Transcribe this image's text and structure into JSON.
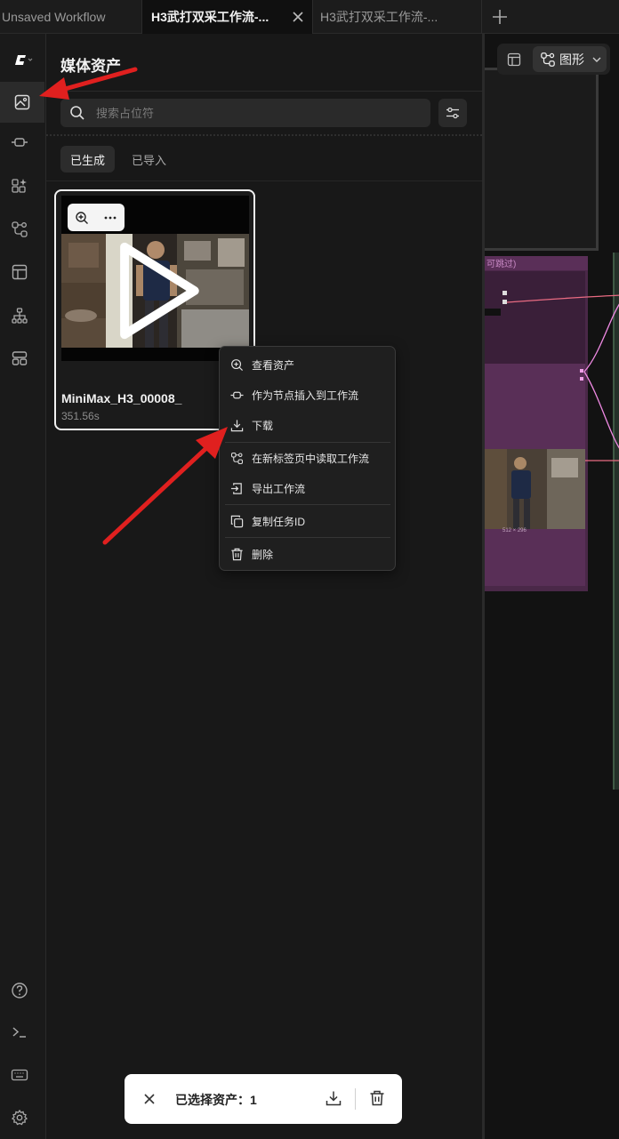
{
  "tabs": [
    {
      "label": "Unsaved Workflow"
    },
    {
      "label": "H3武打双采工作流-..."
    },
    {
      "label": "H3武打双采工作流-..."
    }
  ],
  "panel": {
    "title": "媒体资产",
    "search_placeholder": "搜索占位符",
    "subtabs": [
      "已生成",
      "已导入"
    ]
  },
  "asset": {
    "name": "MiniMax_H3_00008_",
    "duration": "351.56s"
  },
  "context_menu": {
    "items": [
      {
        "label": "查看资产",
        "icon": "zoom-in-icon"
      },
      {
        "label": "作为节点插入到工作流",
        "icon": "node-insert-icon"
      },
      {
        "label": "下载",
        "icon": "download-icon"
      },
      {
        "label": "在新标签页中读取工作流",
        "icon": "workflow-icon"
      },
      {
        "label": "导出工作流",
        "icon": "export-icon"
      },
      {
        "label": "复制任务ID",
        "icon": "copy-icon"
      },
      {
        "label": "删除",
        "icon": "trash-icon"
      }
    ]
  },
  "canvas": {
    "view_mode": "图形",
    "node_header": "可跳过)",
    "thumb_label": "512 × 296"
  },
  "selection_bar": {
    "label": "已选择资产：1"
  },
  "colors": {
    "annotation_arrow": "#e0201f",
    "purple_node": "#4a2848",
    "link_pink": "#e96b82"
  }
}
